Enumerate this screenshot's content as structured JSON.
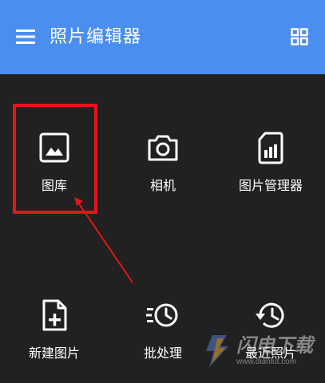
{
  "header": {
    "title": "照片编辑器",
    "background_color": "#4a8ef0",
    "menu_icon": "hamburger-menu-icon",
    "grid_icon": "grid-view-icon"
  },
  "tiles": [
    {
      "label": "图库",
      "icon": "image-icon"
    },
    {
      "label": "相机",
      "icon": "camera-icon"
    },
    {
      "label": "图片管理器",
      "icon": "sd-card-icon"
    },
    {
      "label": "新建图片",
      "icon": "new-file-icon"
    },
    {
      "label": "批处理",
      "icon": "fast-clock-icon"
    },
    {
      "label": "最近照片",
      "icon": "history-icon"
    }
  ],
  "annotation": {
    "highlight_color": "#e3161d",
    "highlighted_tile": "图库"
  },
  "watermark": {
    "text": "闪电下载",
    "url": "www.dianlut.com"
  }
}
